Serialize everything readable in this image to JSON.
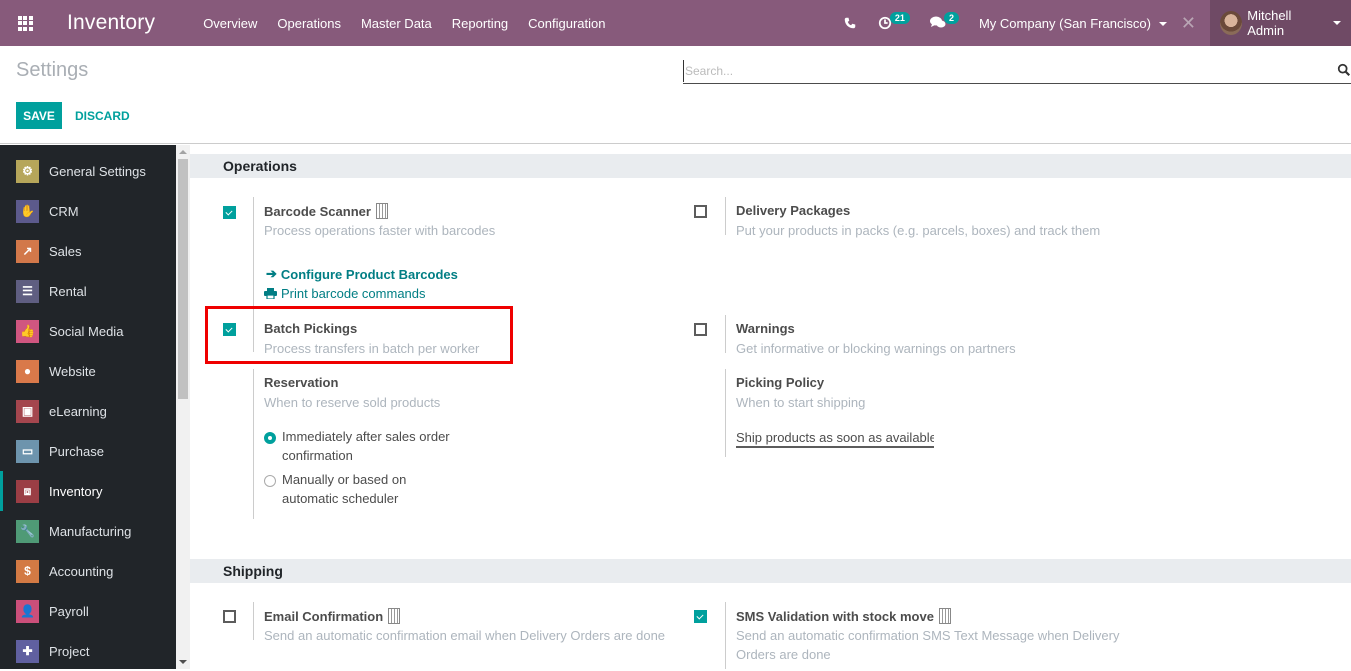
{
  "navbar": {
    "app_name": "Inventory",
    "menu": [
      "Overview",
      "Operations",
      "Master Data",
      "Reporting",
      "Configuration"
    ],
    "activity_count": "21",
    "message_count": "2",
    "company": "My Company (San Francisco)",
    "user": "Mitchell Admin",
    "icons": [
      "apps-grid-icon",
      "phone-icon",
      "activity-clock-icon",
      "chat-icon",
      "debug-close-icon"
    ]
  },
  "control_panel": {
    "title": "Settings",
    "save_label": "SAVE",
    "discard_label": "DISCARD",
    "search_placeholder": "Search...",
    "search_value": ""
  },
  "sidebar": {
    "items": [
      {
        "label": "General Settings",
        "icon": "gear-icon",
        "color": "#b6a65a"
      },
      {
        "label": "CRM",
        "icon": "handshake-icon",
        "color": "#5c5a8c"
      },
      {
        "label": "Sales",
        "icon": "chart-icon",
        "color": "#d2784a"
      },
      {
        "label": "Rental",
        "icon": "rental-icon",
        "color": "#5f5e81"
      },
      {
        "label": "Social Media",
        "icon": "thumbs-up-icon",
        "color": "#d05680"
      },
      {
        "label": "Website",
        "icon": "globe-icon",
        "color": "#d9794a"
      },
      {
        "label": "eLearning",
        "icon": "elearning-icon",
        "color": "#a4464e"
      },
      {
        "label": "Purchase",
        "icon": "credit-card-icon",
        "color": "#6d94ad"
      },
      {
        "label": "Inventory",
        "icon": "box-icon",
        "color": "#9b3e45",
        "active": true
      },
      {
        "label": "Manufacturing",
        "icon": "wrench-icon",
        "color": "#4f9a76"
      },
      {
        "label": "Accounting",
        "icon": "invoice-icon",
        "color": "#d37a44"
      },
      {
        "label": "Payroll",
        "icon": "payroll-icon",
        "color": "#cb4f7a"
      },
      {
        "label": "Project",
        "icon": "puzzle-icon",
        "color": "#6060a0"
      }
    ]
  },
  "sections": {
    "operations": {
      "title": "Operations",
      "barcode": {
        "title": "Barcode Scanner",
        "desc": "Process operations faster with barcodes",
        "checked": true,
        "enterprise": true,
        "link1": "Configure Product Barcodes",
        "link2": "Print barcode commands"
      },
      "packages": {
        "title": "Delivery Packages",
        "desc": "Put your products in packs (e.g. parcels, boxes) and track them",
        "checked": false
      },
      "batch": {
        "title": "Batch Pickings",
        "desc": "Process transfers in batch per worker",
        "checked": true
      },
      "warnings": {
        "title": "Warnings",
        "desc": "Get informative or blocking warnings on partners",
        "checked": false
      },
      "reservation": {
        "title": "Reservation",
        "desc": "When to reserve sold products",
        "options": [
          "Immediately after sales order confirmation",
          "Manually or based on automatic scheduler"
        ],
        "selected": 0
      },
      "picking": {
        "title": "Picking Policy",
        "desc": "When to start shipping",
        "value": "Ship products as soon as available"
      }
    },
    "shipping": {
      "title": "Shipping",
      "email": {
        "title": "Email Confirmation",
        "desc": "Send an automatic confirmation email when Delivery Orders are done",
        "checked": false,
        "enterprise": true
      },
      "sms": {
        "title": "SMS Validation with stock move",
        "desc": "Send an automatic confirmation SMS Text Message when Delivery Orders are done",
        "checked": true,
        "enterprise": true
      }
    }
  },
  "colors": {
    "brand": "#875a7b",
    "accent": "#00a09d",
    "highlight": "#ef0000"
  }
}
